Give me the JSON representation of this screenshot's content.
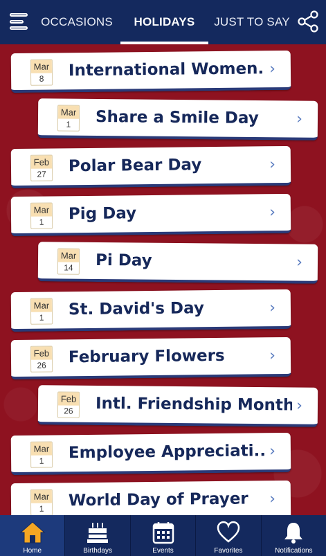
{
  "header": {
    "tabs": [
      {
        "label": "OCCASIONS"
      },
      {
        "label": "HOLIDAYS"
      },
      {
        "label": "JUST TO SAY"
      }
    ]
  },
  "holidays": [
    {
      "month": "Mar",
      "day": "8",
      "title": "International Women..."
    },
    {
      "month": "Mar",
      "day": "1",
      "title": "Share a Smile Day"
    },
    {
      "month": "Feb",
      "day": "27",
      "title": "Polar Bear Day"
    },
    {
      "month": "Mar",
      "day": "1",
      "title": "Pig Day"
    },
    {
      "month": "Mar",
      "day": "14",
      "title": "Pi Day"
    },
    {
      "month": "Mar",
      "day": "1",
      "title": "St. David's Day"
    },
    {
      "month": "Feb",
      "day": "26",
      "title": "February Flowers"
    },
    {
      "month": "Feb",
      "day": "26",
      "title": "Intl. Friendship Month"
    },
    {
      "month": "Mar",
      "day": "1",
      "title": "Employee Appreciati..."
    },
    {
      "month": "Mar",
      "day": "1",
      "title": "World Day of Prayer"
    }
  ],
  "bottom_nav": [
    {
      "label": "Home",
      "icon": "home-icon"
    },
    {
      "label": "Birthdays",
      "icon": "cake-icon"
    },
    {
      "label": "Events",
      "icon": "calendar-icon"
    },
    {
      "label": "Favorites",
      "icon": "heart-icon"
    },
    {
      "label": "Notifications",
      "icon": "bell-icon"
    }
  ],
  "colors": {
    "nav_bg": "#14295e",
    "page_bg": "#8e1220",
    "title_text": "#16285a",
    "home_icon": "#f5a623"
  }
}
